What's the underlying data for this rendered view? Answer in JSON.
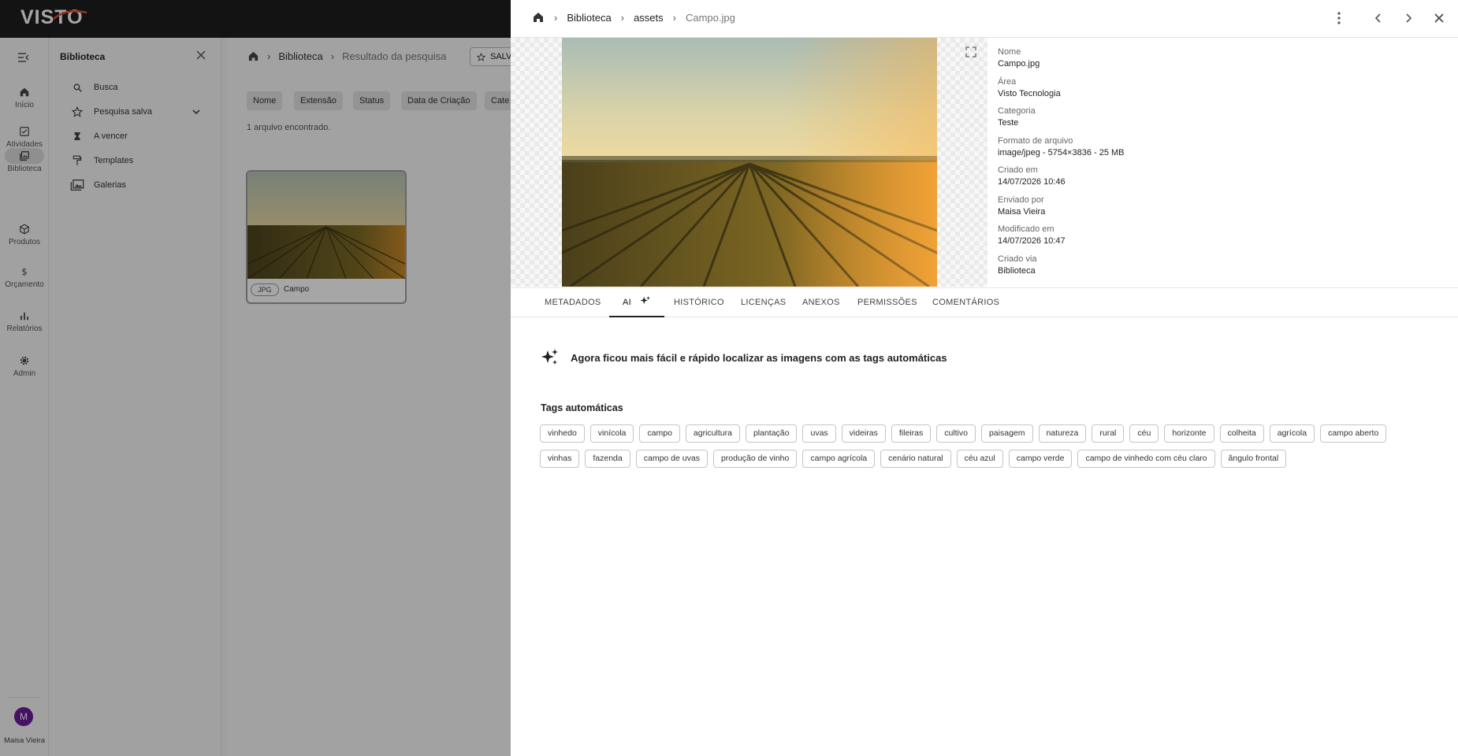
{
  "app": {
    "logo": "VISTO"
  },
  "rail": {
    "items": [
      {
        "label": "Início",
        "icon": "home-icon"
      },
      {
        "label": "Atividades",
        "icon": "checkbox-icon"
      },
      {
        "label": "Biblioteca",
        "icon": "library-icon",
        "active": true
      },
      {
        "label": "Produtos",
        "icon": "package-icon"
      },
      {
        "label": "Orçamento",
        "icon": "dollar-icon"
      },
      {
        "label": "Relatórios",
        "icon": "bar-chart-icon"
      },
      {
        "label": "Admin",
        "icon": "gear-icon"
      }
    ],
    "user_initial": "M",
    "user_name": "Maisa Vieira"
  },
  "library_panel": {
    "title": "Biblioteca",
    "items": [
      {
        "label": "Busca",
        "icon": "search-icon"
      },
      {
        "label": "Pesquisa salva",
        "icon": "star-icon"
      },
      {
        "label": "A vencer",
        "icon": "hourglass-icon"
      },
      {
        "label": "Templates",
        "icon": "paint-roller-icon"
      },
      {
        "label": "Galerias",
        "icon": "gallery-icon"
      }
    ]
  },
  "main": {
    "breadcrumb": {
      "root": "Biblioteca",
      "current": "Resultado da pesquisa"
    },
    "save_label": "SALV",
    "filters": [
      "Nome",
      "Extensão",
      "Status",
      "Data de Criação",
      "Cate"
    ],
    "found_text": "1 arquivo encontrado.",
    "card": {
      "ext": "JPG",
      "name": "Campo"
    }
  },
  "drawer": {
    "breadcrumb": {
      "root": "Biblioteca",
      "folder": "assets",
      "file": "Campo.jpg"
    },
    "meta": [
      {
        "label": "Nome",
        "value": "Campo.jpg"
      },
      {
        "label": "Área",
        "value": "Visto Tecnologia"
      },
      {
        "label": "Categoria",
        "value": "Teste"
      },
      {
        "label": "Formato de arquivo",
        "value": "image/jpeg - 5754×3836 - 25 MB"
      },
      {
        "label": "Criado em",
        "value": "14/07/2026 10:46"
      },
      {
        "label": "Enviado por",
        "value": "Maisa Vieira"
      },
      {
        "label": "Modificado em",
        "value": "14/07/2026 10:47"
      },
      {
        "label": "Criado via",
        "value": "Biblioteca"
      }
    ],
    "tabs": [
      "METADADOS",
      "AI",
      "HISTÓRICO",
      "LICENÇAS",
      "ANEXOS",
      "PERMISSÕES",
      "COMENTÁRIOS"
    ],
    "active_tab": "AI",
    "ai_banner": "Agora ficou mais fácil e rápido localizar as imagens com as tags automáticas",
    "tags_title": "Tags automáticas",
    "tags": [
      "vinhedo",
      "vinícola",
      "campo",
      "agricultura",
      "plantação",
      "uvas",
      "videiras",
      "fileiras",
      "cultivo",
      "paisagem",
      "natureza",
      "rural",
      "céu",
      "horizonte",
      "colheita",
      "agrícola",
      "campo aberto",
      "vinhas",
      "fazenda",
      "campo de uvas",
      "produção de vinho",
      "campo agrícola",
      "cenário natural",
      "céu azul",
      "campo verde",
      "campo de vinhedo com céu claro",
      "ângulo frontal"
    ]
  },
  "colors": {
    "topbar": "#1e1e1e",
    "accent": "#e0502a",
    "avatar": "#6a1b9a"
  }
}
